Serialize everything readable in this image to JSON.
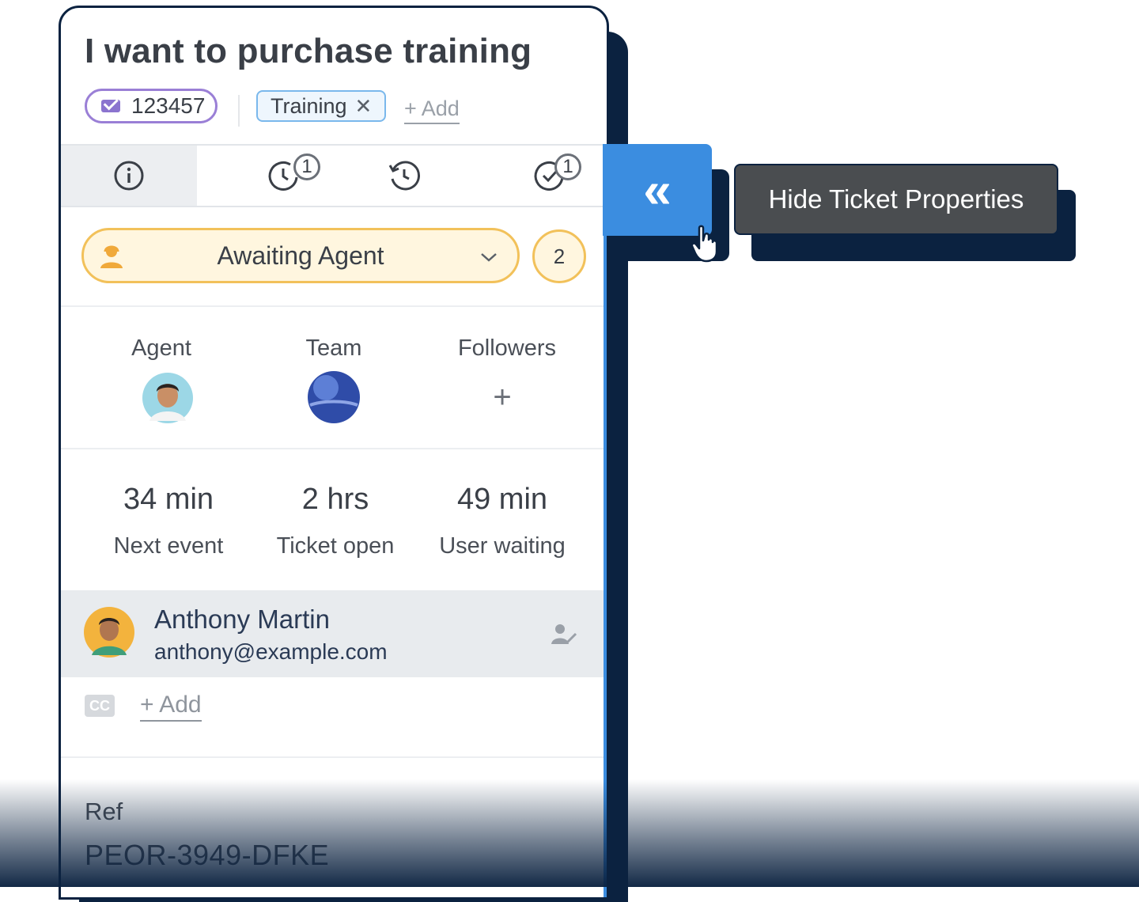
{
  "ticket": {
    "title": "I want to purchase training",
    "id": "123457",
    "tag": "Training",
    "tag_remove": "✕",
    "add_label": "+ Add"
  },
  "tabs": {
    "info_icon": "info-icon",
    "sla_count": "1",
    "history_icon": "history-icon",
    "tasks_count": "1"
  },
  "status": {
    "label": "Awaiting Agent",
    "count": "2"
  },
  "people": {
    "agent_label": "Agent",
    "team_label": "Team",
    "followers_label": "Followers",
    "followers_add": "+"
  },
  "metrics": [
    {
      "value": "34 min",
      "label": "Next event"
    },
    {
      "value": "2 hrs",
      "label": "Ticket open"
    },
    {
      "value": "49 min",
      "label": "User waiting"
    }
  ],
  "contact": {
    "name": "Anthony Martin",
    "email": "anthony@example.com",
    "cc_label": "CC",
    "cc_add": "+ Add"
  },
  "ref": {
    "label": "Ref",
    "value": "PEOR-3949-DFKE"
  },
  "collapse": {
    "icon": "«",
    "tooltip": "Hide Ticket Properties"
  },
  "colors": {
    "accent_blue": "#3b8de0",
    "navy": "#0b2240",
    "status_yellow": "#f2c15a",
    "id_purple": "#9a7fd6"
  }
}
